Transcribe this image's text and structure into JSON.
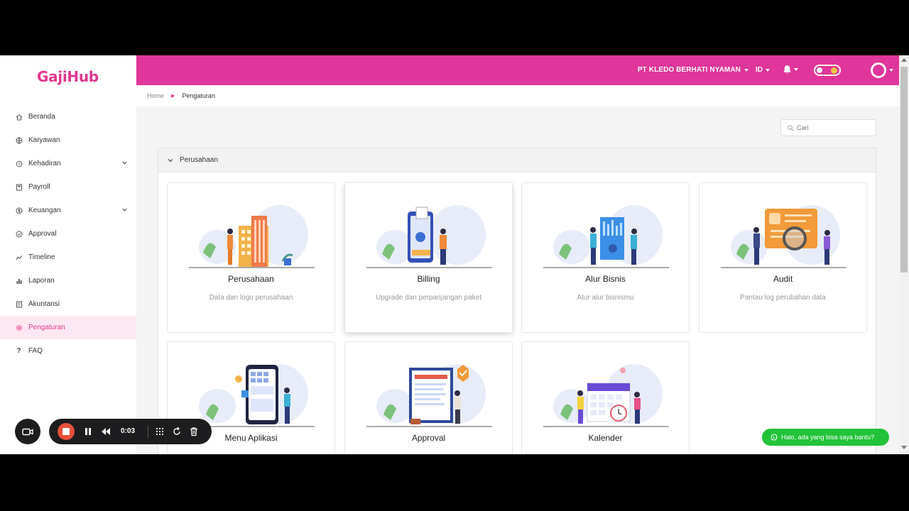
{
  "brand": {
    "logo": "GajiHub",
    "accent": "#e0359a"
  },
  "sidebar": {
    "items": [
      {
        "label": "Beranda",
        "icon": "home-icon"
      },
      {
        "label": "Karyawan",
        "icon": "globe-icon"
      },
      {
        "label": "Kehadiran",
        "icon": "history-icon",
        "expandable": true
      },
      {
        "label": "Payroll",
        "icon": "calculator-icon"
      },
      {
        "label": "Keuangan",
        "icon": "dollar-icon",
        "expandable": true
      },
      {
        "label": "Approval",
        "icon": "check-circle-icon"
      },
      {
        "label": "Timeline",
        "icon": "line-chart-icon"
      },
      {
        "label": "Laporan",
        "icon": "bar-chart-icon"
      },
      {
        "label": "Akuntansi",
        "icon": "book-icon"
      },
      {
        "label": "Pengaturan",
        "icon": "gear-icon",
        "active": true
      },
      {
        "label": "FAQ",
        "icon": "question-icon"
      }
    ]
  },
  "header": {
    "company": "PT KLEDO BERHATI NYAMAN",
    "language": "ID"
  },
  "breadcrumb": {
    "home": "Home",
    "current": "Pengaturan"
  },
  "search": {
    "placeholder": "Cari"
  },
  "section": {
    "title": "Perusahaan",
    "cards": [
      {
        "title": "Perusahaan",
        "desc": "Data dan logo perusahaan"
      },
      {
        "title": "Billing",
        "desc": "Upgrade dan perpanjangan paket"
      },
      {
        "title": "Alur Bisnis",
        "desc": "Atur alur bisnismu"
      },
      {
        "title": "Audit",
        "desc": "Pantau log perubahan data"
      },
      {
        "title": "Menu Aplikasi",
        "desc": ""
      },
      {
        "title": "Approval",
        "desc": ""
      },
      {
        "title": "Kalender",
        "desc": ""
      }
    ]
  },
  "recorder": {
    "time": "0:03"
  },
  "chat": {
    "label": "Halo, ada yang bisa saya bantu?"
  }
}
